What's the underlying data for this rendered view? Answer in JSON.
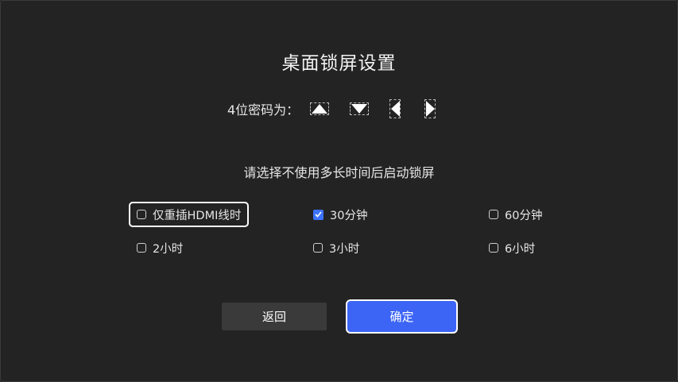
{
  "dialog": {
    "title": "桌面锁屏设置",
    "password_label": "4位密码为：",
    "password_keys": [
      "up-arrow-icon",
      "down-arrow-icon",
      "left-arrow-icon",
      "right-arrow-icon"
    ],
    "subtitle": "请选择不使用多长时间后启动锁屏"
  },
  "options": [
    {
      "label": "仅重插HDMI线时",
      "checked": false,
      "focused": true
    },
    {
      "label": "30分钟",
      "checked": true,
      "focused": false
    },
    {
      "label": "60分钟",
      "checked": false,
      "focused": false
    },
    {
      "label": "2小时",
      "checked": false,
      "focused": false
    },
    {
      "label": "3小时",
      "checked": false,
      "focused": false
    },
    {
      "label": "6小时",
      "checked": false,
      "focused": false
    }
  ],
  "buttons": {
    "back_label": "返回",
    "ok_label": "确定"
  },
  "colors": {
    "background": "#232323",
    "accent": "#3c64f5",
    "checkbox": "#3c73ff"
  }
}
